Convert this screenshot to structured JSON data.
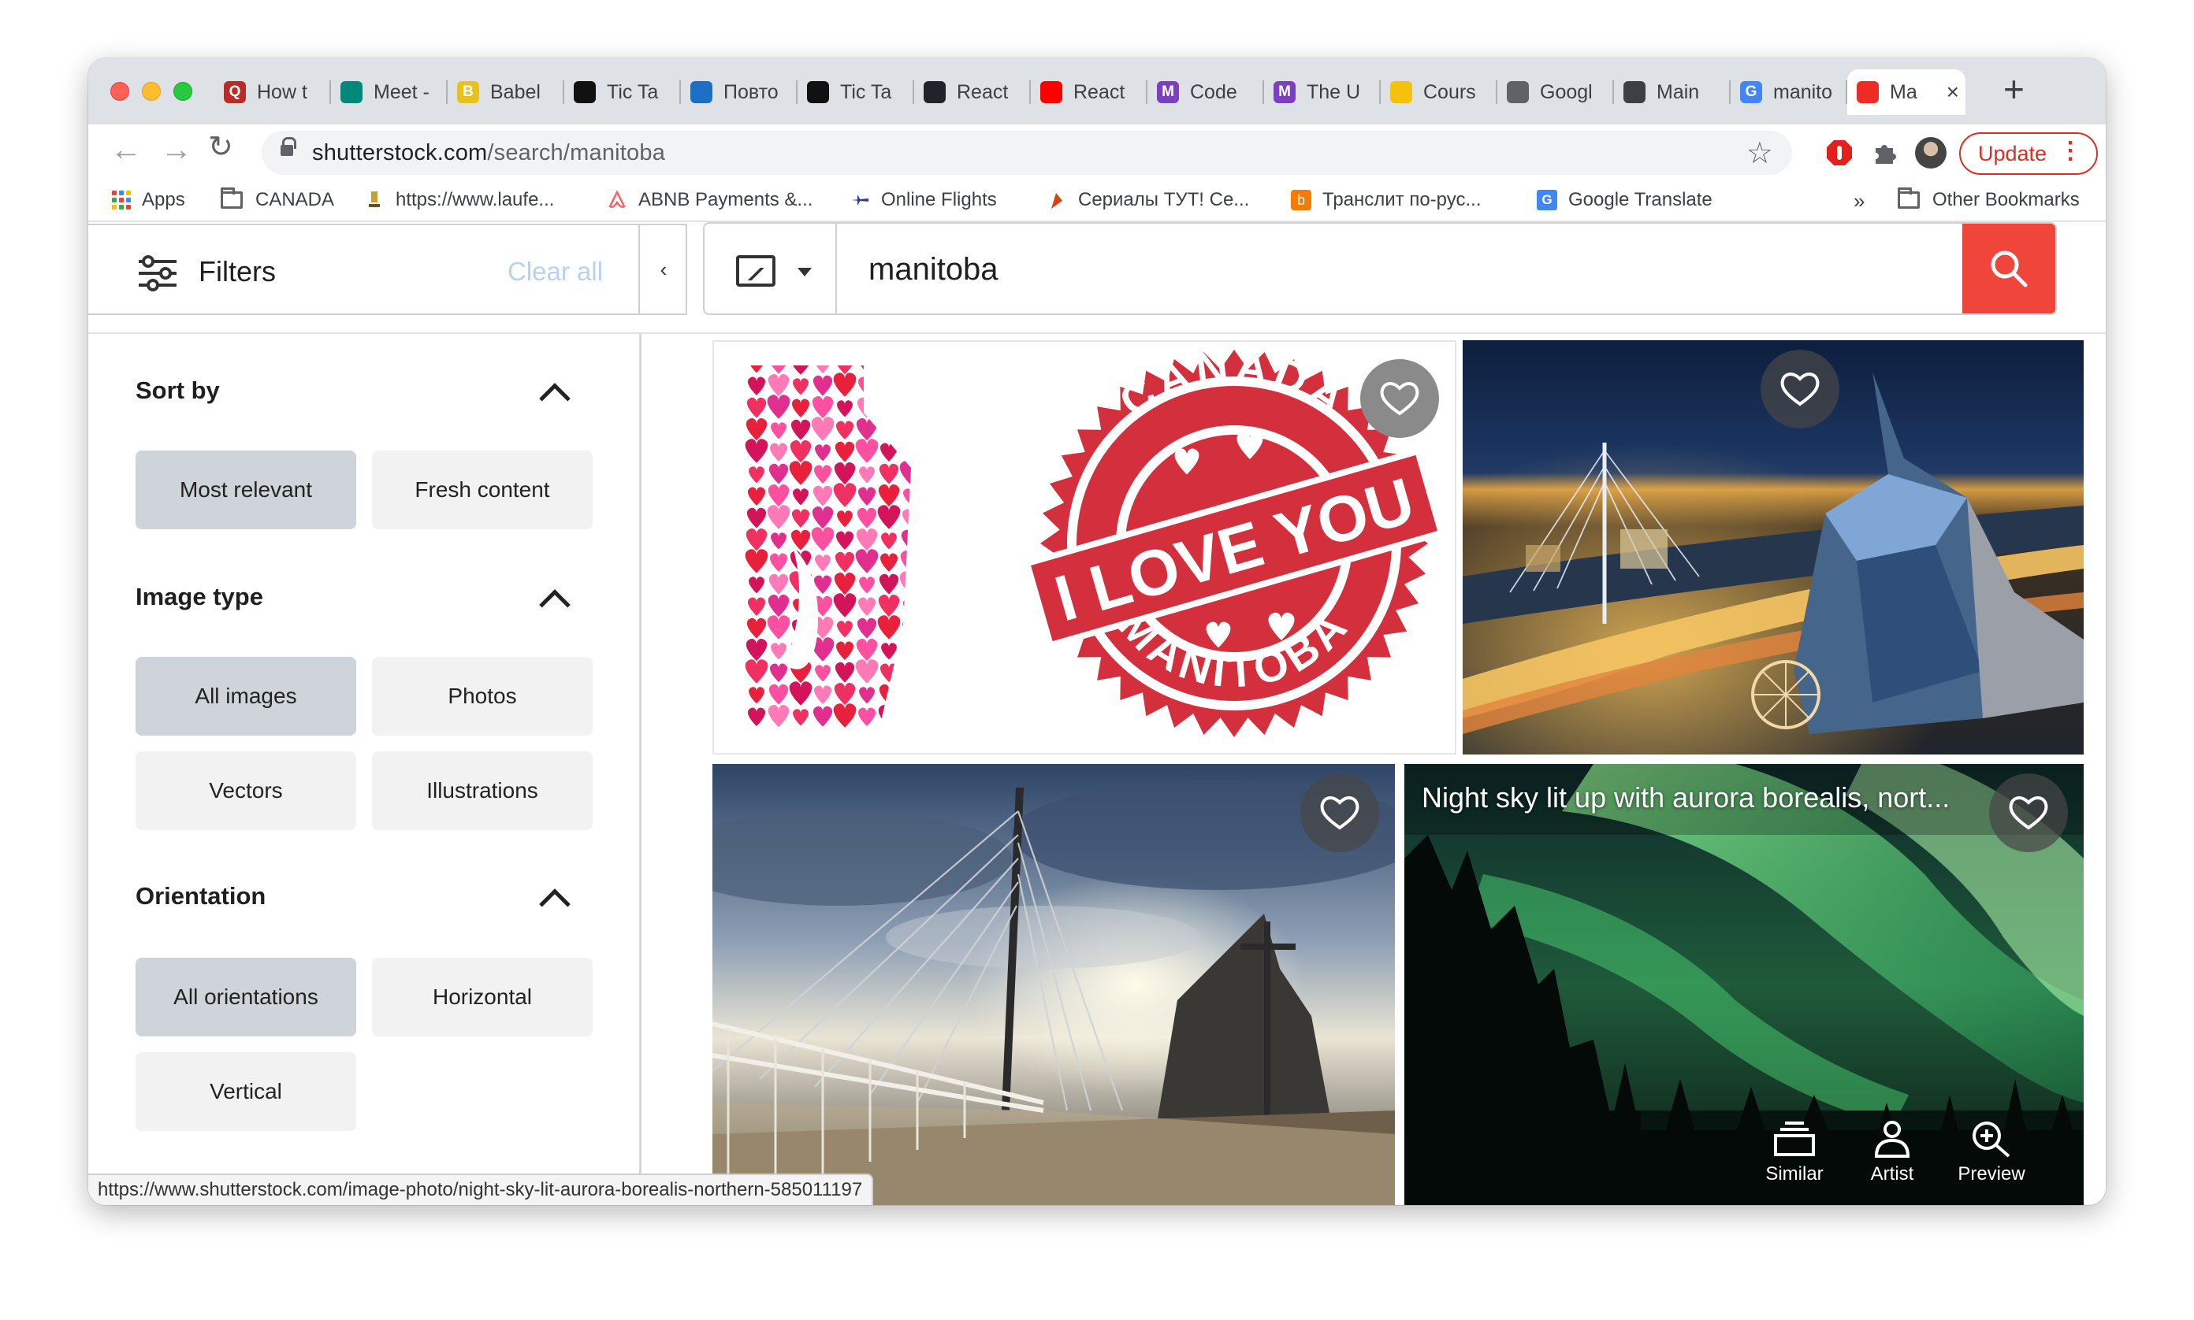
{
  "browser": {
    "tabs": [
      {
        "title": "How t",
        "favicon": "quora-icon",
        "color": "#b92b27",
        "glyph": "Q"
      },
      {
        "title": "Meet -",
        "favicon": "google-meet-icon",
        "color": "#00897b",
        "glyph": ""
      },
      {
        "title": "Babel",
        "favicon": "babel-icon",
        "color": "#e8c21b",
        "glyph": "B"
      },
      {
        "title": "Tic Ta",
        "favicon": "codepen-icon",
        "color": "#111111",
        "glyph": ""
      },
      {
        "title": "Повто",
        "favicon": "yandex-icon",
        "color": "#1c6fc4",
        "glyph": ""
      },
      {
        "title": "Tic Ta",
        "favicon": "codepen-icon",
        "color": "#111111",
        "glyph": ""
      },
      {
        "title": "React",
        "favicon": "react-icon",
        "color": "#20232a",
        "glyph": ""
      },
      {
        "title": "React",
        "favicon": "youtube-icon",
        "color": "#ff0000",
        "glyph": ""
      },
      {
        "title": "Code",
        "favicon": "codewars-icon",
        "color": "#7b3fbf",
        "glyph": "M"
      },
      {
        "title": "The U",
        "favicon": "codewars-icon",
        "color": "#7b3fbf",
        "glyph": "M"
      },
      {
        "title": "Cours",
        "favicon": "crown-icon",
        "color": "#f4c20d",
        "glyph": ""
      },
      {
        "title": "Googl",
        "favicon": "photos-icon",
        "color": "#5f6368",
        "glyph": ""
      },
      {
        "title": "Main",
        "favicon": "globe-icon",
        "color": "#3c4043",
        "glyph": ""
      },
      {
        "title": "manito",
        "favicon": "google-icon",
        "color": "#4285f4",
        "glyph": "G"
      },
      {
        "title": "Ma",
        "favicon": "shutterstock-icon",
        "color": "#ee2b24",
        "glyph": ""
      }
    ],
    "active_tab_index": 14,
    "url_main": "shutterstock.com",
    "url_path": "/search/manitoba",
    "update_label": "Update",
    "bookmarks": [
      {
        "label": "Apps",
        "icon": "apps-grid-icon"
      },
      {
        "label": "CANADA",
        "icon": "folder-icon"
      },
      {
        "label": "https://www.laufe...",
        "icon": "trophy-icon"
      },
      {
        "label": "ABNB Payments &...",
        "icon": "airbnb-icon"
      },
      {
        "label": "Online Flights",
        "icon": "plane-icon"
      },
      {
        "label": "Сериалы ТУТ! Се...",
        "icon": "film-icon"
      },
      {
        "label": "Транслит по-рус...",
        "icon": "translit-icon"
      },
      {
        "label": "Google Translate",
        "icon": "translate-icon"
      }
    ],
    "bookmarks_overflow": "»",
    "other_bookmarks": "Other Bookmarks",
    "status_url": "https://www.shutterstock.com/image-photo/night-sky-lit-aurora-borealis-northern-585011197"
  },
  "filters": {
    "title": "Filters",
    "clear_all": "Clear all",
    "collapse": "‹",
    "sections": [
      {
        "title": "Sort by",
        "options": [
          "Most relevant",
          "Fresh content"
        ],
        "selected": "Most relevant"
      },
      {
        "title": "Image type",
        "options": [
          "All images",
          "Photos",
          "Vectors",
          "Illustrations"
        ],
        "selected": "All images"
      },
      {
        "title": "Orientation",
        "options": [
          "All orientations",
          "Horizontal",
          "Vertical"
        ],
        "selected": "All orientations"
      }
    ]
  },
  "search": {
    "query": "manitoba"
  },
  "results": {
    "items": [
      {
        "kind": "vector",
        "stamp_top": "CANADA",
        "stamp_mid": "I LOVE YOU",
        "stamp_bottom": "MANITOBA"
      },
      {
        "kind": "photo",
        "subject": "winnipeg-night-skyline"
      },
      {
        "kind": "photo",
        "subject": "esplanade-riel-bridge"
      },
      {
        "kind": "photo",
        "subject": "aurora-borealis",
        "caption": "Night sky lit up with aurora borealis, nort..."
      }
    ],
    "hover_tools": [
      "Similar",
      "Artist",
      "Preview"
    ]
  },
  "colors": {
    "accent": "#f0453a",
    "update_red": "#d93025",
    "chip_selected": "#cfd4da",
    "chip": "#f2f2f2",
    "clear_all": "#b9d2ec"
  }
}
